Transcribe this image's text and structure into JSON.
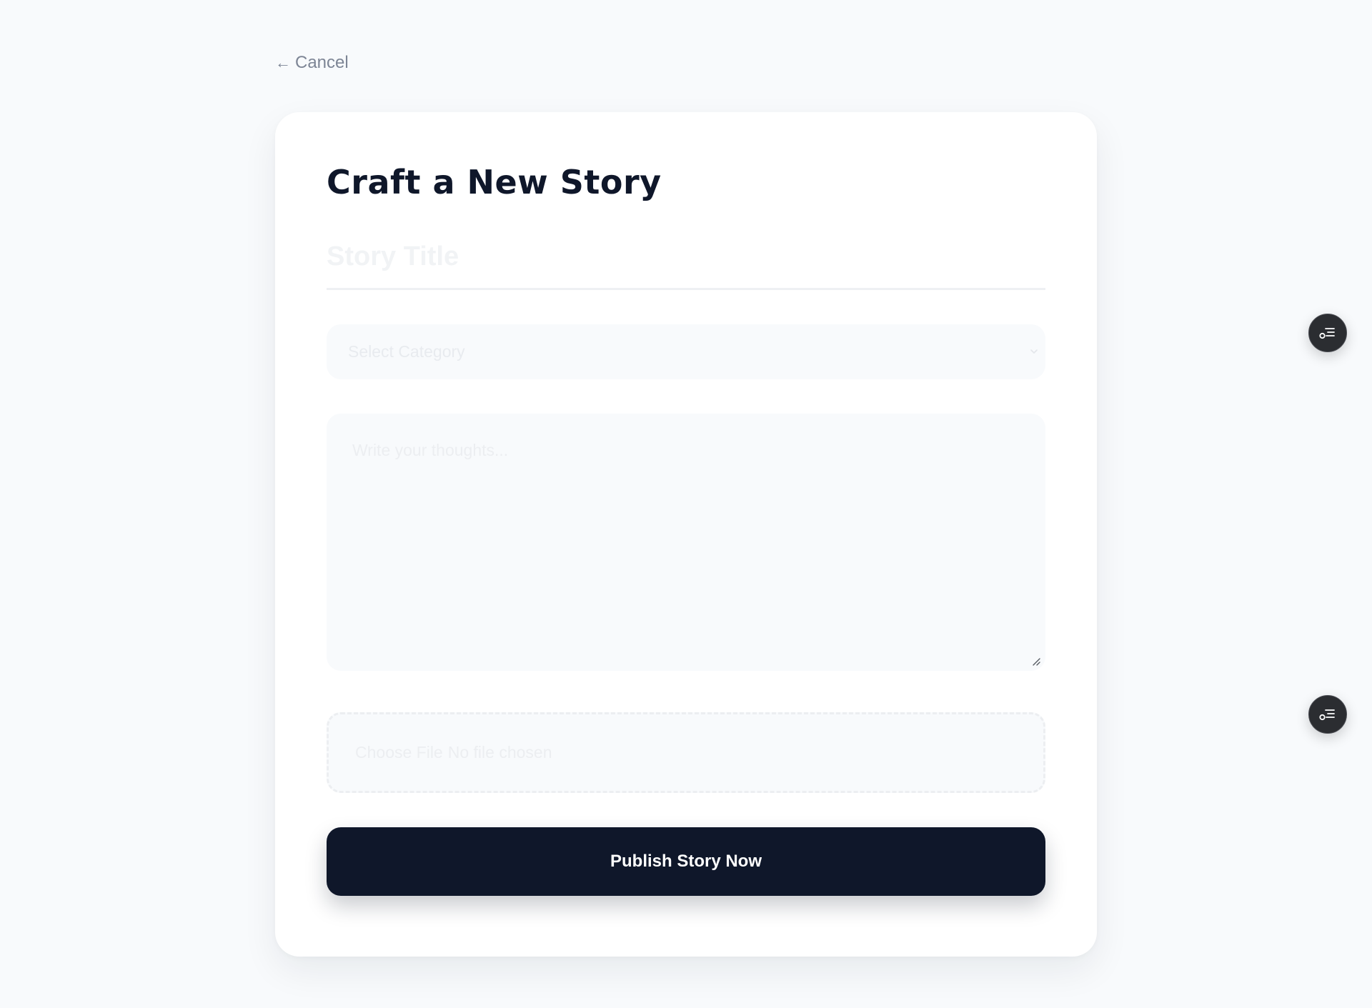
{
  "nav": {
    "cancel_arrow": "←",
    "cancel_label": "Cancel"
  },
  "form": {
    "heading": "Craft a New Story",
    "title_placeholder": "Story Title",
    "category_selected": "Select Category",
    "body_placeholder": "Write your thoughts...",
    "file_button_label": "Choose File",
    "file_status": "No file chosen",
    "publish_label": "Publish Story Now"
  },
  "floating_buttons": [
    {
      "icon": "list-settings-icon"
    },
    {
      "icon": "list-settings-icon"
    }
  ],
  "colors": {
    "background": "#f8fafc",
    "card": "#ffffff",
    "primary": "#0f172a",
    "muted_text": "#7d8595",
    "floating_button": "#2b2d31"
  }
}
